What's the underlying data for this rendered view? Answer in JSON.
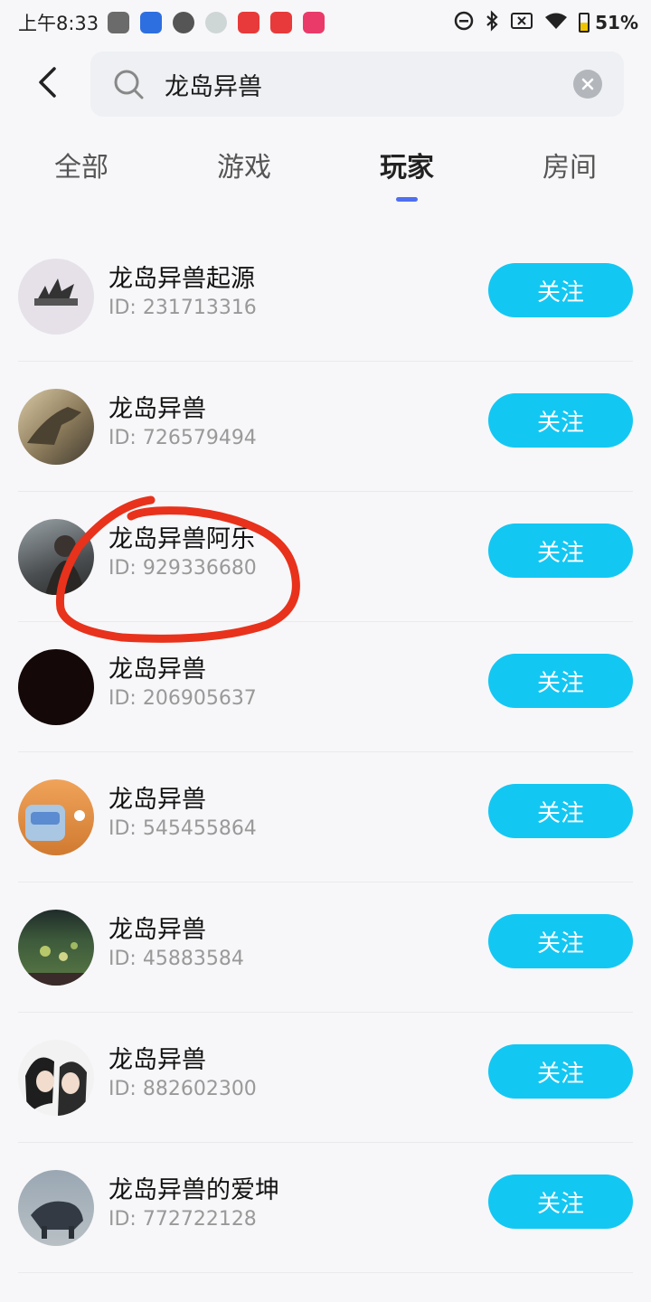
{
  "status_bar": {
    "time": "上午8:33",
    "battery": "51%",
    "battery_level": 0.51
  },
  "search": {
    "query": "龙岛异兽"
  },
  "tabs": [
    {
      "label": "全部",
      "active": false
    },
    {
      "label": "游戏",
      "active": false
    },
    {
      "label": "玩家",
      "active": true
    },
    {
      "label": "房间",
      "active": false
    }
  ],
  "results": [
    {
      "name": "龙岛异兽起源",
      "id": "ID: 231713316",
      "follow": "关注",
      "avatar": "game-logo"
    },
    {
      "name": "龙岛异兽",
      "id": "ID: 726579494",
      "follow": "关注",
      "avatar": "dinosaur"
    },
    {
      "name": "龙岛异兽阿乐",
      "id": "ID: 929336680",
      "follow": "关注",
      "avatar": "man-photo"
    },
    {
      "name": "龙岛异兽",
      "id": "ID: 206905637",
      "follow": "关注",
      "avatar": "dark"
    },
    {
      "name": "龙岛异兽",
      "id": "ID: 545455864",
      "follow": "关注",
      "avatar": "cartoon"
    },
    {
      "name": "龙岛异兽",
      "id": "ID: 45883584",
      "follow": "关注",
      "avatar": "game-screenshot"
    },
    {
      "name": "龙岛异兽",
      "id": "ID: 882602300",
      "follow": "关注",
      "avatar": "anime-couple"
    },
    {
      "name": "龙岛异兽的爱坤",
      "id": "ID: 772722128",
      "follow": "关注",
      "avatar": "creature"
    }
  ],
  "colors": {
    "accent": "#13c7f3",
    "tab_indicator": "#4f6ff0",
    "annotation": "#e8321c"
  }
}
